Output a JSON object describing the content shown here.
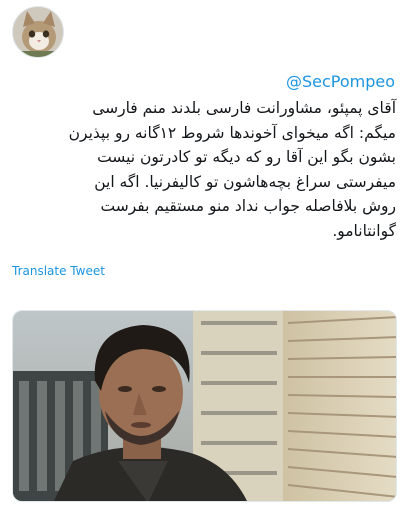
{
  "tweet": {
    "mention": "@SecPompeo",
    "body": "آقای پمپئو، مشاورانت فارسی بلدند منم فارسی\nمیگم: اگه میخوای آخوندها شروط ۱۲گانه رو بپذیرن\nبشون بگو این آقا رو که دیگه تو کادرتون نیست\nمیفرستی سراغ بچه‌هاشون تو کالیفرنیا. اگه این\nروش بلافاصله جواب نداد منو مستقیم بفرست\nگوانتانامو.",
    "translate_label": "Translate Tweet"
  },
  "icons": {
    "avatar": "cat-avatar-icon",
    "media": "tweet-photo-image"
  }
}
